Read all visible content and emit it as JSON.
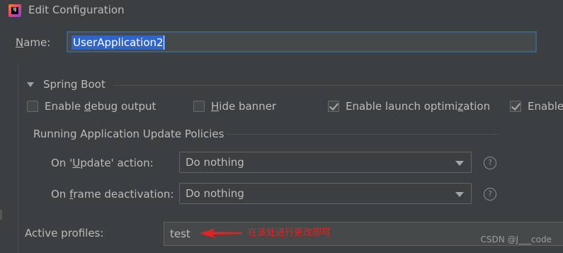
{
  "window": {
    "title": "Edit Configuration",
    "logo_text": "IJ"
  },
  "name_field": {
    "label": "Name:",
    "value": "UserApplication2"
  },
  "section": {
    "title": "Spring Boot"
  },
  "checkboxes": [
    {
      "label_pre": "Enable ",
      "mnemonic": "d",
      "label_post": "ebug output",
      "checked": false
    },
    {
      "label_pre": "",
      "mnemonic": "H",
      "label_post": "ide banner",
      "checked": false
    },
    {
      "label_pre": "Enable launch optimi",
      "mnemonic": "z",
      "label_post": "ation",
      "checked": true
    },
    {
      "label_pre": "Enable",
      "mnemonic": "",
      "label_post": "",
      "checked": true
    }
  ],
  "policies": {
    "title": "Running Application Update Policies",
    "update_action": {
      "label": "On 'Update' action:",
      "value": "Do nothing"
    },
    "frame_deactivation": {
      "label": "On frame deactivation:",
      "value": "Do nothing"
    },
    "help_glyph": "?"
  },
  "active_profiles": {
    "label": "Active profiles:",
    "value": "test"
  },
  "annotation": {
    "text": "在该处进行更改即可",
    "color": "#e52222"
  },
  "watermark": "CSDN @J___code",
  "colors": {
    "background": "#3c3f41",
    "selection": "#2f65ca",
    "focus_border": "#3d6185",
    "text": "#bbbbbb"
  }
}
